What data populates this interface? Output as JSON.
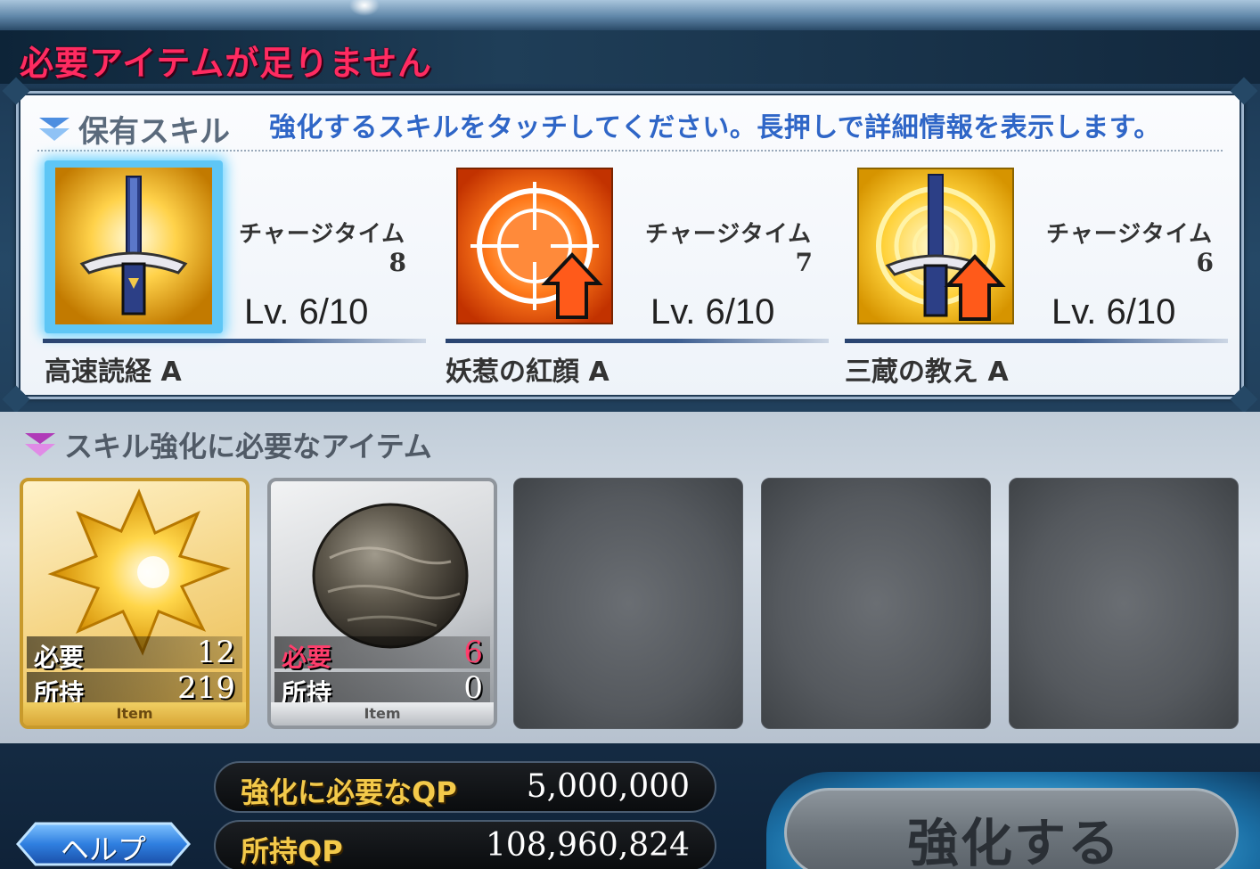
{
  "warning": {
    "title": "必要アイテムが足りません"
  },
  "skills_section": {
    "header": "保有スキル",
    "instruction": "強化するスキルをタッチしてください。長押しで詳細情報を表示します。",
    "skills": [
      {
        "name": "高速読経 A",
        "charge_label": "チャージタイム",
        "charge_value": "8",
        "level": "Lv. 6/10",
        "icon": "sword-radiant-icon",
        "selected": true
      },
      {
        "name": "妖惹の紅顔 A",
        "charge_label": "チャージタイム",
        "charge_value": "7",
        "level": "Lv. 6/10",
        "icon": "target-crosshair-up-icon",
        "selected": false
      },
      {
        "name": "三蔵の教え A",
        "charge_label": "チャージタイム",
        "charge_value": "6",
        "level": "Lv. 6/10",
        "icon": "sword-rings-up-icon",
        "selected": false
      }
    ]
  },
  "items_section": {
    "header": "スキル強化に必要なアイテム",
    "items": [
      {
        "icon": "gold-star-gem-icon",
        "required_label": "必要",
        "required": "12",
        "owned_label": "所持",
        "owned": "219",
        "tag": "Item",
        "insufficient": false
      },
      {
        "icon": "stone-ball-icon",
        "required_label": "必要",
        "required": "6",
        "owned_label": "所持",
        "owned": "0",
        "tag": "Item",
        "insufficient": true
      }
    ],
    "empty_slots": 3
  },
  "qp": {
    "required_label": "強化に必要なQP",
    "required_value": "5,000,000",
    "owned_label": "所持QP",
    "owned_value": "108,960,824"
  },
  "buttons": {
    "help": "ヘルプ",
    "enhance": "強化する"
  },
  "colors": {
    "warning_text": "#ff2b61",
    "instruction_text": "#2f66c7",
    "qp_label": "#f3c94a",
    "selected_glow": "#6fd4ff"
  }
}
